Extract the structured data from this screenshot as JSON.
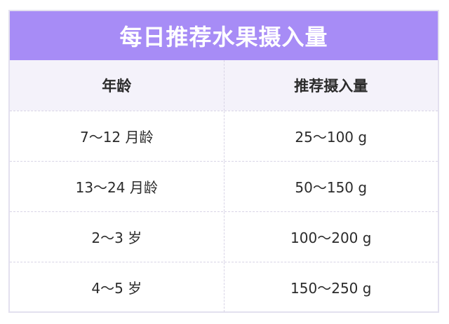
{
  "title": "每日推荐水果摄入量",
  "columns": [
    "年龄",
    "推荐摄入量"
  ],
  "rows": [
    {
      "age": "7～12 月龄",
      "amount": "25～100 g"
    },
    {
      "age": "13～24 月龄",
      "amount": "50～150 g"
    },
    {
      "age": "2～3 岁",
      "amount": "100～200 g"
    },
    {
      "age": "4～5 岁",
      "amount": "150～250 g"
    }
  ],
  "colors": {
    "title_bg": "#a78cf6",
    "title_text": "#ffffff",
    "header_bg": "#f4f2fa",
    "border": "#e3e0ef",
    "divider": "#d8d4e6"
  }
}
